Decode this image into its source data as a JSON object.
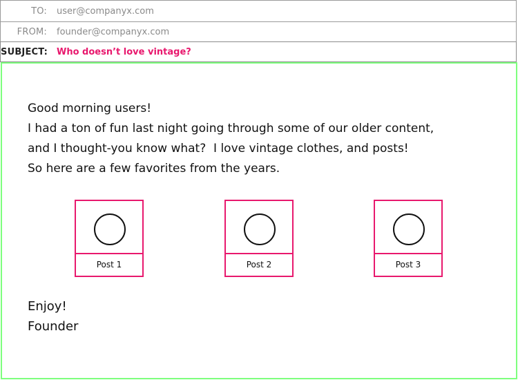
{
  "header": {
    "to": {
      "label": "TO:",
      "value": "user@companyx.com"
    },
    "from": {
      "label": "FROM:",
      "value": "founder@companyx.com"
    },
    "subject": {
      "label": "SUBJECT:",
      "value": "Who doesn’t love vintage?"
    }
  },
  "body": {
    "lines": [
      "Good morning users!",
      "I had a ton of fun last night going through some of our older content,",
      "and I thought-you know what?  I love vintage clothes, and posts!",
      "So here are a few favorites from the years."
    ],
    "posts": [
      {
        "label": "Post 1",
        "icon": "circle-placeholder-icon"
      },
      {
        "label": "Post 2",
        "icon": "circle-placeholder-icon"
      },
      {
        "label": "Post 3",
        "icon": "circle-placeholder-icon"
      }
    ],
    "signoff": [
      "Enjoy!",
      "Founder"
    ]
  },
  "colors": {
    "accent": "#e8186d",
    "frame": "#7dff7d",
    "header_text": "#8a8a8a"
  }
}
